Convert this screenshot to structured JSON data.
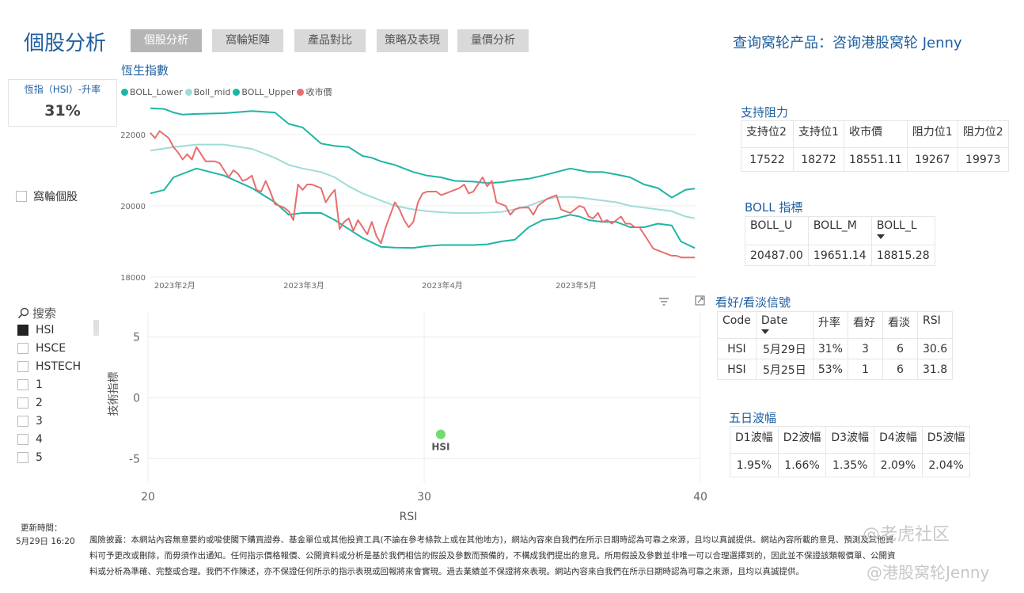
{
  "header": {
    "title": "個股分析",
    "tabs": [
      {
        "label": "個股分析",
        "active": true
      },
      {
        "label": "窩輪矩陣",
        "active": false
      },
      {
        "label": "產品對比",
        "active": false
      },
      {
        "label": "策略及表現",
        "active": false
      },
      {
        "label": "量價分析",
        "active": false
      }
    ],
    "query_link": "查询窝轮产品：咨询港股窝轮 Jenny"
  },
  "kpi": {
    "label": "恆指（HSI）-升率",
    "value": "31%"
  },
  "warrant_filter": {
    "label": "窩輪個股"
  },
  "hsi_chart": {
    "title": "恆生指數",
    "legend": [
      {
        "name": "BOLL_Lower",
        "color": "#1fb5a4"
      },
      {
        "name": "Boll_mid",
        "color": "#9fdcd8"
      },
      {
        "name": "BOLL_Upper",
        "color": "#1fb5a4"
      },
      {
        "name": "收市價",
        "color": "#e86d6d"
      }
    ]
  },
  "chart_data": [
    {
      "type": "line",
      "title": "恆生指數",
      "x_ticks": [
        "2023年2月",
        "2023年3月",
        "2023年4月",
        "2023年5月"
      ],
      "y_ticks": [
        18000,
        20000,
        22000
      ],
      "ylim": [
        18000,
        23000
      ],
      "x_days": "days since 2023-01-31",
      "xlim": [
        0,
        118
      ],
      "series": [
        {
          "name": "BOLL_Upper",
          "color": "#1fb5a4",
          "x": [
            0,
            3,
            5,
            7,
            10,
            16,
            22,
            27,
            30,
            33,
            37,
            40,
            43,
            46,
            48,
            50,
            53,
            57,
            60,
            63,
            66,
            70,
            73,
            76,
            79,
            82,
            85,
            88,
            91,
            93,
            95,
            98,
            101,
            104,
            107,
            110,
            113,
            116,
            118
          ],
          "y": [
            22740,
            22720,
            22620,
            22560,
            22580,
            22600,
            22660,
            22620,
            22300,
            22200,
            21750,
            21680,
            21650,
            21400,
            21350,
            21250,
            21150,
            20950,
            20850,
            20800,
            20700,
            20680,
            20640,
            20660,
            20720,
            20760,
            20850,
            20950,
            21050,
            21000,
            20950,
            20950,
            20880,
            20800,
            20600,
            20500,
            20230,
            20450,
            20487
          ]
        },
        {
          "name": "Boll_mid",
          "color": "#9fdcd8",
          "x": [
            0,
            5,
            10,
            16,
            22,
            27,
            30,
            33,
            37,
            40,
            43,
            46,
            50,
            53,
            57,
            60,
            63,
            66,
            70,
            73,
            76,
            79,
            82,
            85,
            88,
            91,
            93,
            95,
            98,
            101,
            104,
            107,
            110,
            113,
            116,
            118
          ],
          "y": [
            21550,
            21650,
            21720,
            21720,
            21600,
            21350,
            21150,
            21050,
            20950,
            20800,
            20550,
            20350,
            20150,
            20000,
            19900,
            19850,
            19820,
            19800,
            19800,
            19810,
            19830,
            19900,
            20000,
            20150,
            20250,
            20250,
            20230,
            20200,
            20150,
            20100,
            20000,
            19950,
            19900,
            19850,
            19700,
            19651
          ]
        },
        {
          "name": "BOLL_Lower",
          "color": "#1fb5a4",
          "x": [
            0,
            3,
            5,
            7,
            10,
            16,
            22,
            27,
            30,
            33,
            37,
            40,
            43,
            46,
            50,
            53,
            57,
            60,
            63,
            66,
            70,
            73,
            76,
            79,
            82,
            85,
            88,
            91,
            93,
            95,
            98,
            101,
            104,
            107,
            110,
            113,
            115,
            118
          ],
          "y": [
            20350,
            20450,
            20800,
            20900,
            21050,
            20850,
            20500,
            20100,
            19750,
            19800,
            19800,
            19600,
            19350,
            19100,
            18850,
            18830,
            18820,
            18870,
            18900,
            18900,
            18900,
            18920,
            19000,
            19050,
            19400,
            19600,
            19650,
            19750,
            19700,
            19600,
            19550,
            19550,
            19400,
            19400,
            19500,
            19450,
            19000,
            18815
          ]
        },
        {
          "name": "收市價",
          "color": "#e86d6d",
          "x": [
            0,
            1,
            2,
            3,
            4,
            5,
            6,
            7,
            8,
            9,
            10,
            12,
            13,
            14,
            15,
            16,
            17,
            18,
            19,
            20,
            21,
            22,
            23,
            24,
            25,
            26,
            27,
            28,
            29,
            30,
            31,
            32,
            33,
            34,
            35,
            36,
            37,
            38,
            39,
            40,
            41,
            42,
            43,
            44,
            45,
            46,
            47,
            48,
            49,
            50,
            51,
            52,
            53,
            54,
            55,
            56,
            57,
            58,
            59,
            60,
            61,
            62,
            63,
            64,
            65,
            66,
            67,
            68,
            69,
            70,
            71,
            72,
            73,
            74,
            75,
            76,
            77,
            78,
            79,
            80,
            81,
            82,
            83,
            84,
            85,
            86,
            87,
            88,
            89,
            90,
            91,
            92,
            93,
            94,
            95,
            96,
            97,
            98,
            99,
            100,
            101,
            102,
            103,
            104,
            105,
            106,
            107,
            108,
            109,
            110,
            111,
            112,
            113,
            114,
            115,
            116,
            117,
            118
          ],
          "y": [
            22050,
            21900,
            22100,
            22000,
            21900,
            21650,
            21500,
            21300,
            21450,
            21300,
            21650,
            21250,
            21250,
            21250,
            21200,
            21000,
            20800,
            21000,
            20900,
            20700,
            20750,
            20850,
            20450,
            20400,
            20700,
            20400,
            20050,
            20000,
            19950,
            19850,
            19600,
            20600,
            20450,
            20600,
            20600,
            20550,
            20500,
            20100,
            20300,
            20450,
            19350,
            19550,
            19650,
            19300,
            19600,
            19400,
            19200,
            19550,
            19150,
            18950,
            19400,
            19750,
            20100,
            19900,
            19600,
            19400,
            19550,
            20100,
            20350,
            20400,
            20400,
            20400,
            20300,
            20350,
            20400,
            20450,
            20500,
            20600,
            20350,
            20400,
            20600,
            20800,
            20550,
            20700,
            20100,
            20050,
            20000,
            19750,
            19900,
            19950,
            19950,
            19950,
            19750,
            20000,
            20100,
            20200,
            20250,
            20300,
            19900,
            19850,
            19800,
            19900,
            20000,
            19950,
            19700,
            19650,
            19800,
            19550,
            19600,
            19500,
            19600,
            19700,
            19500,
            19500,
            19400,
            19400,
            19200,
            19000,
            18800,
            18750,
            18700,
            18650,
            18600,
            18600,
            18551,
            18551,
            18551,
            18551
          ]
        }
      ]
    },
    {
      "type": "scatter",
      "xlabel": "RSI",
      "ylabel": "技術指標",
      "xlim": [
        20,
        40
      ],
      "ylim": [
        -7,
        7
      ],
      "x_ticks": [
        20,
        30,
        40
      ],
      "y_ticks": [
        5,
        0,
        -5
      ],
      "points": [
        {
          "label": "HSI",
          "x": 30.6,
          "y": -3,
          "color": "#6fdc6f"
        }
      ]
    }
  ],
  "support_resistance": {
    "title": "支持阻力",
    "columns": [
      "支持位2",
      "支持位1",
      "收市價",
      "阻力位1",
      "阻力位2"
    ],
    "rows": [
      [
        "17522",
        "18272",
        "18551.11",
        "19267",
        "19973"
      ]
    ]
  },
  "boll_table": {
    "title": "BOLL 指標",
    "columns": [
      "BOLL_U",
      "BOLL_M",
      "BOLL_L"
    ],
    "rows": [
      [
        "20487.00",
        "19651.14",
        "18815.28"
      ]
    ]
  },
  "search": {
    "placeholder": "搜索"
  },
  "slicer": {
    "items": [
      {
        "label": "HSI",
        "checked": true
      },
      {
        "label": "HSCE",
        "checked": false
      },
      {
        "label": "HSTECH",
        "checked": false
      },
      {
        "label": "1",
        "checked": false
      },
      {
        "label": "2",
        "checked": false
      },
      {
        "label": "3",
        "checked": false
      },
      {
        "label": "4",
        "checked": false
      },
      {
        "label": "5",
        "checked": false
      }
    ]
  },
  "signals": {
    "title": "看好/看淡信號",
    "columns": [
      "Code",
      "Date",
      "升率",
      "看好",
      "看淡",
      "RSI"
    ],
    "rows": [
      [
        "HSI",
        "5月29日",
        "31%",
        "3",
        "6",
        "30.6"
      ],
      [
        "HSI",
        "5月25日",
        "53%",
        "1",
        "6",
        "31.8"
      ]
    ]
  },
  "volatility": {
    "title": "五日波幅",
    "columns": [
      "D1波幅",
      "D2波幅",
      "D3波幅",
      "D4波幅",
      "D5波幅"
    ],
    "rows": [
      [
        "1.95%",
        "1.66%",
        "1.35%",
        "2.09%",
        "2.04%"
      ]
    ]
  },
  "footer": {
    "update_label": "更新時間：",
    "update_time": "5月29日 16:20",
    "disclaimer_lines": [
      "風險披露：本網站內容無意要約或唆使閣下購買證券、基金單位或其他投資工具(不論在參考條款上或在其他地方)，網站內容來自我們在所示日期時認為可靠之來源，且均以真誠提供。網站內容所載的意見、預測及其他資",
      "料可予更改或刪除，而毋須作出通知。任何指示價格報價、公開資料或分析是基於我們相信的假設及參數而預備的，不構成我們提出的意見。所用假設及參數並非唯一可以合理選擇到的，因此並不保證該類報價單、公開資",
      "料或分析為準確、完整或合理。我們不作陳述，亦不保證任何所示的指示表現或回報將來會實現。過去業績並不保證將來表現。網站內容來自我們在所示日期時認為可靠之來源，且均以真誠提供。"
    ],
    "watermark_1": "@老虎社区",
    "watermark_2": "@港股窝轮Jenny"
  }
}
